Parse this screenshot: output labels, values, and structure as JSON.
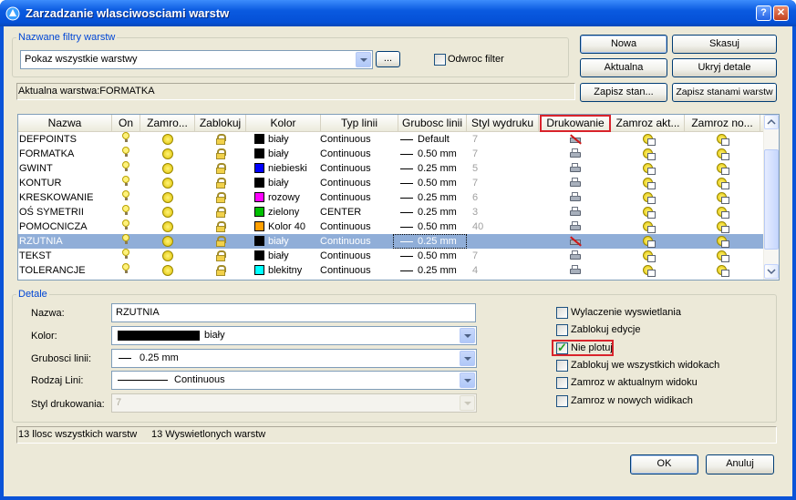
{
  "window": {
    "title": "Zarzadzanie wlasciwosciami warstw",
    "help_label": "?",
    "close_label": "✕"
  },
  "filters": {
    "group_label": "Nazwane filtry warstw",
    "selected": "Pokaz wszystkie warstwy",
    "browse_label": "...",
    "invert_label": "Odwroc filter",
    "invert_checked": false
  },
  "buttons": {
    "new": "Nowa",
    "delete": "Skasuj",
    "current": "Aktualna",
    "hide_details": "Ukryj detale",
    "save_state": "Zapisz stan...",
    "state_manager": "Zapisz stanami warstw",
    "ok": "OK",
    "cancel": "Anuluj"
  },
  "current_layer": "Aktualna warstwa:FORMATKA",
  "columns": [
    "Nazwa",
    "On",
    "Zamro...",
    "Zablokuj",
    "Kolor",
    "Typ linii",
    "Grubosc linii",
    "Styl wydruku",
    "Drukowanie",
    "Zamroz akt...",
    "Zamroz no..."
  ],
  "highlighted_column": "Drukowanie",
  "layers": [
    {
      "name": "DEFPOINTS",
      "color": "biały",
      "swatch": "#000000",
      "linetype": "Continuous",
      "lineweight": "Default",
      "plotstyle": "7",
      "plot": false,
      "selected": false
    },
    {
      "name": "FORMATKA",
      "color": "biały",
      "swatch": "#000000",
      "linetype": "Continuous",
      "lineweight": "0.50 mm",
      "plotstyle": "7",
      "plot": true,
      "selected": false
    },
    {
      "name": "GWINT",
      "color": "niebieski",
      "swatch": "#0000ff",
      "linetype": "Continuous",
      "lineweight": "0.25 mm",
      "plotstyle": "5",
      "plot": true,
      "selected": false
    },
    {
      "name": "KONTUR",
      "color": "biały",
      "swatch": "#000000",
      "linetype": "Continuous",
      "lineweight": "0.50 mm",
      "plotstyle": "7",
      "plot": true,
      "selected": false
    },
    {
      "name": "KRESKOWANIE",
      "color": "rozowy",
      "swatch": "#ff00ff",
      "linetype": "Continuous",
      "lineweight": "0.25 mm",
      "plotstyle": "6",
      "plot": true,
      "selected": false
    },
    {
      "name": "OŚ SYMETRII",
      "color": "zielony",
      "swatch": "#00c000",
      "linetype": "CENTER",
      "lineweight": "0.25 mm",
      "plotstyle": "3",
      "plot": true,
      "selected": false
    },
    {
      "name": "POMOCNICZA",
      "color": "Kolor 40",
      "swatch": "#ff9f00",
      "linetype": "Continuous",
      "lineweight": "0.50 mm",
      "plotstyle": "40",
      "plot": true,
      "selected": false
    },
    {
      "name": "RZUTNIA",
      "color": "biały",
      "swatch": "#000000",
      "linetype": "Continuous",
      "lineweight": "0.25 mm",
      "plotstyle": "",
      "plot": false,
      "selected": true
    },
    {
      "name": "TEKST",
      "color": "biały",
      "swatch": "#000000",
      "linetype": "Continuous",
      "lineweight": "0.50 mm",
      "plotstyle": "7",
      "plot": true,
      "selected": false
    },
    {
      "name": "TOLERANCJE",
      "color": "blekitny",
      "swatch": "#00ffff",
      "linetype": "Continuous",
      "lineweight": "0.25 mm",
      "plotstyle": "4",
      "plot": true,
      "selected": false
    }
  ],
  "details": {
    "group_label": "Detale",
    "name_label": "Nazwa:",
    "name_value": "RZUTNIA",
    "color_label": "Kolor:",
    "color_value": "biały",
    "lineweight_label": "Grubosci linii:",
    "lineweight_value": "0.25 mm",
    "linetype_label": "Rodzaj Lini:",
    "linetype_value": "Continuous",
    "plotstyle_label": "Styl drukowania:",
    "plotstyle_value": "7",
    "options": [
      {
        "label": "Wylaczenie wyswietlania",
        "checked": false,
        "highlight": false
      },
      {
        "label": "Zablokuj edycje",
        "checked": false,
        "highlight": false
      },
      {
        "label": "Nie plotuj",
        "checked": true,
        "highlight": true
      },
      {
        "label": "Zablokuj we wszystkich widokach",
        "checked": false,
        "highlight": false
      },
      {
        "label": "Zamroz w aktualnym widoku",
        "checked": false,
        "highlight": false
      },
      {
        "label": "Zamroz w nowych widikach",
        "checked": false,
        "highlight": false
      }
    ]
  },
  "status": {
    "total": "13 llosc wszystkich warstw",
    "shown": "13 Wyswietlonych warstw"
  },
  "colors": {
    "highlight_border": "#d9232b",
    "selection": "#90aed8"
  }
}
